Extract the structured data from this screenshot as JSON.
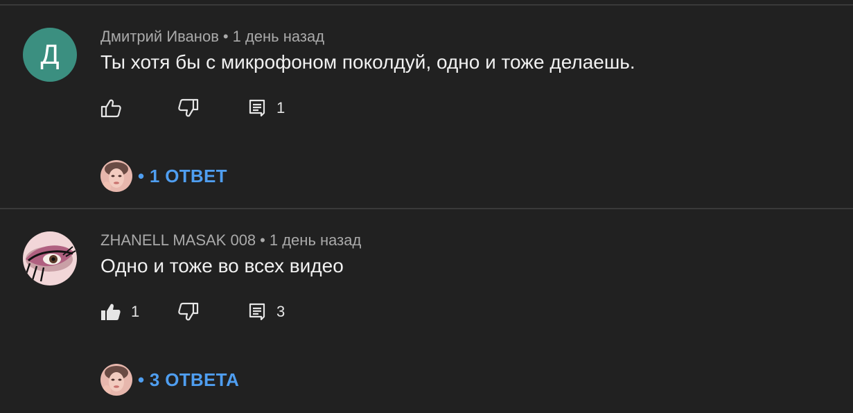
{
  "comments": [
    {
      "author": "Дмитрий Иванов",
      "avatar_letter": "Д",
      "avatar_color": "#3b8f80",
      "time": "1 день назад",
      "separator": "•",
      "text": "Ты хотя бы с микрофоном поколдуй, одно и тоже делаешь.",
      "likes": "",
      "liked": false,
      "reply_count": "1",
      "replies_label": "• 1 ОТВЕТ"
    },
    {
      "author": "ZHANELL MASAK 008",
      "avatar_letter": "",
      "time": "1 день назад",
      "separator": "•",
      "text": "Одно и тоже во всех видео",
      "likes": "1",
      "liked": true,
      "reply_count": "3",
      "replies_label": "• 3 ОТВЕТА"
    }
  ],
  "colors": {
    "background": "#212121",
    "divider": "#3a3a3a",
    "meta_text": "#aaaaaa",
    "body_text": "#f1f1f1",
    "link_blue": "#4f9ef0"
  },
  "icons": {
    "like": "thumb-up-icon",
    "dislike": "thumb-down-icon",
    "reply": "comment-icon"
  }
}
